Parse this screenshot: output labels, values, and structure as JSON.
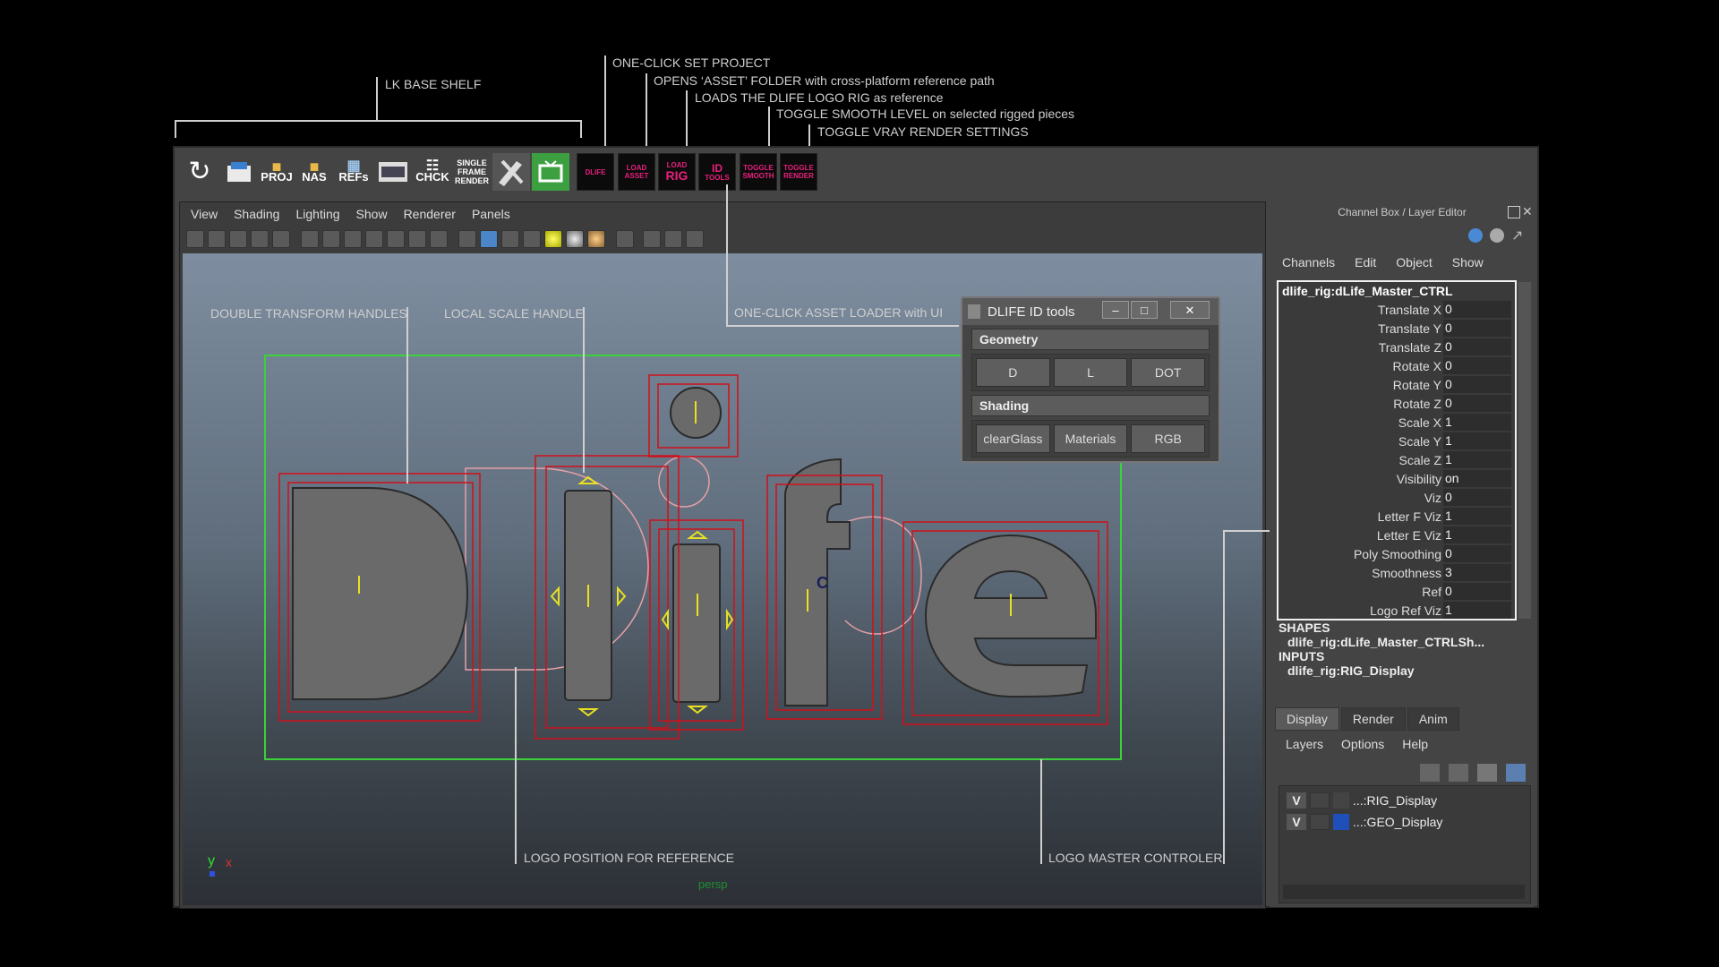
{
  "annotations": {
    "shelf": "LK BASE SHELF",
    "set_project": "ONE-CLICK SET PROJECT",
    "opens_asset": "OPENS ‘ASSET’ FOLDER with cross-platform reference path",
    "loads_rig": "LOADS THE DLIFE LOGO RIG as reference",
    "toggle_smooth": "TOGGLE SMOOTH LEVEL on selected rigged pieces",
    "toggle_vray": "TOGGLE VRAY RENDER SETTINGS",
    "double_transform": "DOUBLE TRANSFORM HANDLES",
    "local_scale": "LOCAL SCALE HANDLE",
    "asset_loader": "ONE-CLICK ASSET LOADER with UI",
    "logo_position": "LOGO POSITION FOR REFERENCE",
    "logo_master": "LOGO MASTER CONTROLER"
  },
  "shelf": {
    "proj": "PROJ",
    "nas": "NAS",
    "refs": "REFs",
    "chck": "CHCK",
    "single_frame": [
      "SINGLE",
      "FRAME",
      "RENDER"
    ],
    "dlife": "DLIFE",
    "load_asset": [
      "LOAD",
      "ASSET"
    ],
    "load_rig": [
      "LOAD",
      "RIG"
    ],
    "id_tools": [
      "ID",
      "TOOLS"
    ],
    "toggle_smooth": [
      "TOGGLE",
      "SMOOTH"
    ],
    "toggle_render": [
      "TOGGLE",
      "RENDER"
    ]
  },
  "viewport": {
    "menu": [
      "View",
      "Shading",
      "Lighting",
      "Show",
      "Renderer",
      "Panels"
    ],
    "camera_label": "persp",
    "axis_y": "y",
    "axis_x": "x",
    "letter_c": "C",
    "logo_letters": "Dlife"
  },
  "dlife_window": {
    "title": "DLIFE ID tools",
    "geometry_label": "Geometry",
    "geometry_buttons": [
      "D",
      "L",
      "DOT"
    ],
    "shading_label": "Shading",
    "shading_buttons": [
      "clearGlass",
      "Materials",
      "RGB"
    ]
  },
  "channel_box": {
    "title": "Channel Box / Layer Editor",
    "menu": [
      "Channels",
      "Edit",
      "Object",
      "Show"
    ],
    "object": "dlife_rig:dLife_Master_CTRL",
    "channels": [
      {
        "name": "Translate X",
        "value": "0"
      },
      {
        "name": "Translate Y",
        "value": "0"
      },
      {
        "name": "Translate Z",
        "value": "0"
      },
      {
        "name": "Rotate X",
        "value": "0"
      },
      {
        "name": "Rotate Y",
        "value": "0"
      },
      {
        "name": "Rotate Z",
        "value": "0"
      },
      {
        "name": "Scale X",
        "value": "1"
      },
      {
        "name": "Scale Y",
        "value": "1"
      },
      {
        "name": "Scale Z",
        "value": "1"
      },
      {
        "name": "Visibility",
        "value": "on"
      },
      {
        "name": "Viz",
        "value": "0"
      },
      {
        "name": "Letter F Viz",
        "value": "1"
      },
      {
        "name": "Letter E Viz",
        "value": "1"
      },
      {
        "name": "Poly Smoothing",
        "value": "0"
      },
      {
        "name": "Smoothness",
        "value": "3"
      },
      {
        "name": "Ref",
        "value": "0"
      },
      {
        "name": "Logo Ref Viz",
        "value": "1"
      }
    ],
    "shapes_label": "SHAPES",
    "shapes_item": "dlife_rig:dLife_Master_CTRLSh...",
    "inputs_label": "INPUTS",
    "inputs_item": "dlife_rig:RIG_Display"
  },
  "layer_editor": {
    "tabs": [
      "Display",
      "Render",
      "Anim"
    ],
    "menu": [
      "Layers",
      "Options",
      "Help"
    ],
    "layers": [
      {
        "v": "V",
        "name": "...:RIG_Display",
        "color": "#444444"
      },
      {
        "v": "V",
        "name": "...:GEO_Display",
        "color": "#1f4fb8"
      }
    ]
  },
  "colors": {
    "selection_red": "#d0101a",
    "bbox_green": "#3bd23b",
    "handle_yellow": "#e8e020",
    "shelf_pink": "#e8207c"
  }
}
